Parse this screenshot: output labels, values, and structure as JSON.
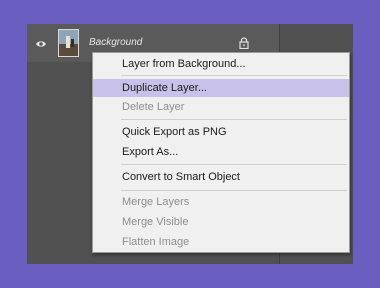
{
  "layer": {
    "name": "Background",
    "icons": {
      "visibility": "eye-icon",
      "lock": "lock-icon"
    }
  },
  "menu": {
    "items": [
      {
        "label": "Layer from Background...",
        "enabled": true
      },
      {
        "label": "Duplicate Layer...",
        "enabled": true,
        "highlighted": true
      },
      {
        "label": "Delete Layer",
        "enabled": false
      },
      {
        "label": "Quick Export as PNG",
        "enabled": true
      },
      {
        "label": "Export As...",
        "enabled": true
      },
      {
        "label": "Convert to Smart Object",
        "enabled": true
      },
      {
        "label": "Merge Layers",
        "enabled": false
      },
      {
        "label": "Merge Visible",
        "enabled": false
      },
      {
        "label": "Flatten Image",
        "enabled": false
      }
    ]
  },
  "colors": {
    "background": "#6a5fc1",
    "panel": "#505050",
    "menu_bg": "#f0f0f0",
    "highlight": "#c8c2ea",
    "disabled_text": "#8e8e8e"
  }
}
